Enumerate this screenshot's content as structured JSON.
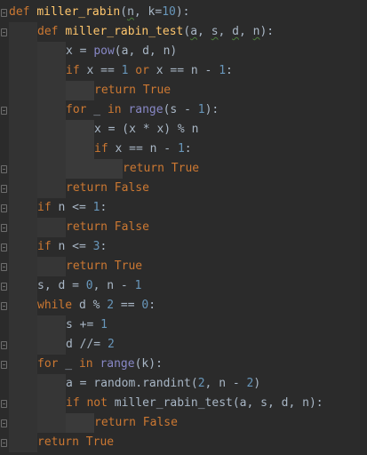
{
  "editor": {
    "language": "Python",
    "theme": "Darcula",
    "colors": {
      "background": "#2b2b2b",
      "keyword": "#cc7832",
      "function": "#ffc66d",
      "number": "#6897bb",
      "builtin": "#8888c6",
      "text": "#a9b7c6",
      "indent_guide_1": "#333333",
      "indent_guide_2": "#363636",
      "indent_guide_3": "#3a3a3a"
    },
    "lines": [
      {
        "indent": 0,
        "tokens": [
          {
            "t": "def",
            "c": "kw"
          },
          {
            "t": " ",
            "c": "op"
          },
          {
            "t": "miller_rabin",
            "c": "fn"
          },
          {
            "t": "(",
            "c": "op"
          },
          {
            "t": "n",
            "c": "var",
            "squig": true
          },
          {
            "t": ", k=",
            "c": "op"
          },
          {
            "t": "10",
            "c": "num"
          },
          {
            "t": "):",
            "c": "op"
          }
        ]
      },
      {
        "indent": 1,
        "tokens": [
          {
            "t": "def",
            "c": "kw"
          },
          {
            "t": " ",
            "c": "op"
          },
          {
            "t": "miller_rabin_test",
            "c": "fn"
          },
          {
            "t": "(",
            "c": "op"
          },
          {
            "t": "a",
            "c": "var",
            "squig": true
          },
          {
            "t": ", ",
            "c": "op"
          },
          {
            "t": "s",
            "c": "var",
            "squig": true
          },
          {
            "t": ", ",
            "c": "op"
          },
          {
            "t": "d",
            "c": "var",
            "squig": true
          },
          {
            "t": ", ",
            "c": "op"
          },
          {
            "t": "n",
            "c": "var",
            "squig": true
          },
          {
            "t": "):",
            "c": "op"
          }
        ]
      },
      {
        "indent": 2,
        "tokens": [
          {
            "t": "x = ",
            "c": "op"
          },
          {
            "t": "pow",
            "c": "bi"
          },
          {
            "t": "(a, d, n)",
            "c": "op"
          }
        ]
      },
      {
        "indent": 2,
        "tokens": [
          {
            "t": "if",
            "c": "kw"
          },
          {
            "t": " x == ",
            "c": "op"
          },
          {
            "t": "1",
            "c": "num"
          },
          {
            "t": " ",
            "c": "op"
          },
          {
            "t": "or",
            "c": "kw"
          },
          {
            "t": " x == n - ",
            "c": "op"
          },
          {
            "t": "1",
            "c": "num"
          },
          {
            "t": ":",
            "c": "op"
          }
        ]
      },
      {
        "indent": 3,
        "tokens": [
          {
            "t": "return",
            "c": "kw"
          },
          {
            "t": " ",
            "c": "op"
          },
          {
            "t": "True",
            "c": "kw"
          }
        ]
      },
      {
        "indent": 2,
        "tokens": [
          {
            "t": "for",
            "c": "kw"
          },
          {
            "t": " _ ",
            "c": "op"
          },
          {
            "t": "in",
            "c": "kw"
          },
          {
            "t": " ",
            "c": "op"
          },
          {
            "t": "range",
            "c": "bi"
          },
          {
            "t": "(s - ",
            "c": "op"
          },
          {
            "t": "1",
            "c": "num"
          },
          {
            "t": "):",
            "c": "op"
          }
        ]
      },
      {
        "indent": 3,
        "tokens": [
          {
            "t": "x = (x * x) % n",
            "c": "op"
          }
        ]
      },
      {
        "indent": 3,
        "tokens": [
          {
            "t": "if",
            "c": "kw"
          },
          {
            "t": " x == n - ",
            "c": "op"
          },
          {
            "t": "1",
            "c": "num"
          },
          {
            "t": ":",
            "c": "op"
          }
        ]
      },
      {
        "indent": 4,
        "tokens": [
          {
            "t": "return",
            "c": "kw"
          },
          {
            "t": " ",
            "c": "op"
          },
          {
            "t": "True",
            "c": "kw"
          }
        ]
      },
      {
        "indent": 2,
        "tokens": [
          {
            "t": "return",
            "c": "kw"
          },
          {
            "t": " ",
            "c": "op"
          },
          {
            "t": "False",
            "c": "kw"
          }
        ]
      },
      {
        "indent": 1,
        "tokens": [
          {
            "t": "if",
            "c": "kw"
          },
          {
            "t": " n <= ",
            "c": "op"
          },
          {
            "t": "1",
            "c": "num"
          },
          {
            "t": ":",
            "c": "op"
          }
        ]
      },
      {
        "indent": 2,
        "tokens": [
          {
            "t": "return",
            "c": "kw"
          },
          {
            "t": " ",
            "c": "op"
          },
          {
            "t": "False",
            "c": "kw"
          }
        ]
      },
      {
        "indent": 1,
        "tokens": [
          {
            "t": "if",
            "c": "kw"
          },
          {
            "t": " n <= ",
            "c": "op"
          },
          {
            "t": "3",
            "c": "num"
          },
          {
            "t": ":",
            "c": "op"
          }
        ]
      },
      {
        "indent": 2,
        "tokens": [
          {
            "t": "return",
            "c": "kw"
          },
          {
            "t": " ",
            "c": "op"
          },
          {
            "t": "True",
            "c": "kw"
          }
        ]
      },
      {
        "indent": 1,
        "tokens": [
          {
            "t": "s, d = ",
            "c": "op"
          },
          {
            "t": "0",
            "c": "num"
          },
          {
            "t": ", n - ",
            "c": "op"
          },
          {
            "t": "1",
            "c": "num"
          }
        ]
      },
      {
        "indent": 1,
        "tokens": [
          {
            "t": "while",
            "c": "kw"
          },
          {
            "t": " d % ",
            "c": "op"
          },
          {
            "t": "2",
            "c": "num"
          },
          {
            "t": " == ",
            "c": "op"
          },
          {
            "t": "0",
            "c": "num"
          },
          {
            "t": ":",
            "c": "op"
          }
        ]
      },
      {
        "indent": 2,
        "tokens": [
          {
            "t": "s += ",
            "c": "op"
          },
          {
            "t": "1",
            "c": "num"
          }
        ]
      },
      {
        "indent": 2,
        "tokens": [
          {
            "t": "d //= ",
            "c": "op"
          },
          {
            "t": "2",
            "c": "num"
          }
        ]
      },
      {
        "indent": 1,
        "tokens": [
          {
            "t": "for",
            "c": "kw"
          },
          {
            "t": " _ ",
            "c": "op"
          },
          {
            "t": "in",
            "c": "kw"
          },
          {
            "t": " ",
            "c": "op"
          },
          {
            "t": "range",
            "c": "bi"
          },
          {
            "t": "(k):",
            "c": "op"
          }
        ]
      },
      {
        "indent": 2,
        "tokens": [
          {
            "t": "a = random.randint(",
            "c": "op"
          },
          {
            "t": "2",
            "c": "num"
          },
          {
            "t": ", n - ",
            "c": "op"
          },
          {
            "t": "2",
            "c": "num"
          },
          {
            "t": ")",
            "c": "op"
          }
        ]
      },
      {
        "indent": 2,
        "tokens": [
          {
            "t": "if",
            "c": "kw"
          },
          {
            "t": " ",
            "c": "op"
          },
          {
            "t": "not",
            "c": "kw"
          },
          {
            "t": " miller_rabin_test(a, s, d, n):",
            "c": "op"
          }
        ]
      },
      {
        "indent": 3,
        "tokens": [
          {
            "t": "return",
            "c": "kw"
          },
          {
            "t": " ",
            "c": "op"
          },
          {
            "t": "False",
            "c": "kw"
          }
        ]
      },
      {
        "indent": 1,
        "tokens": [
          {
            "t": "return",
            "c": "kw"
          },
          {
            "t": " ",
            "c": "op"
          },
          {
            "t": "True",
            "c": "kw"
          }
        ]
      }
    ],
    "fold_markers": [
      0,
      1,
      5,
      8,
      9,
      10,
      11,
      12,
      13,
      14,
      15,
      17,
      18,
      20,
      21,
      22
    ]
  }
}
